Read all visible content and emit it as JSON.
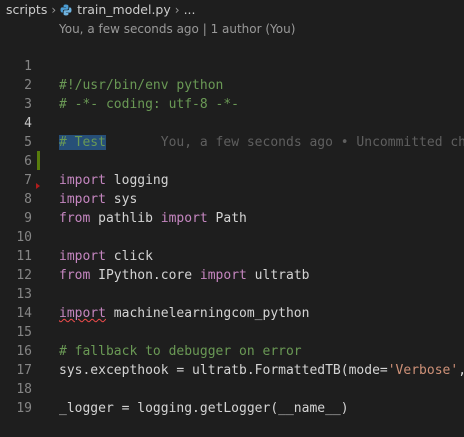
{
  "breadcrumb": {
    "folder": "scripts",
    "file": "train_model.py",
    "ellipsis": "..."
  },
  "codelens": "You, a few seconds ago | 1 author (You)",
  "blame": "You, a few seconds ago • Uncommitted chan",
  "colors": {
    "comment": "#6a9955",
    "keyword": "#c586c0",
    "string": "#ce9178",
    "selection": "#264f78"
  },
  "lines": [
    {
      "n": "1",
      "text": "#!/usr/bin/env python"
    },
    {
      "n": "2",
      "text": "# -*- coding: utf-8 -*-"
    },
    {
      "n": "3",
      "text": ""
    },
    {
      "n": "4",
      "text": "# Test"
    },
    {
      "n": "5",
      "text": ""
    },
    {
      "n": "6",
      "kw1": "import",
      "rest1": " logging"
    },
    {
      "n": "7",
      "kw1": "import",
      "rest1": " sys"
    },
    {
      "n": "8",
      "kw1": "from",
      "rest1": " pathlib ",
      "kw2": "import",
      "rest2": " Path"
    },
    {
      "n": "9",
      "text": ""
    },
    {
      "n": "10",
      "kw1": "import",
      "rest1": " click"
    },
    {
      "n": "11",
      "kw1": "from",
      "rest1": " IPython.core ",
      "kw2": "import",
      "rest2": " ultratb"
    },
    {
      "n": "12",
      "text": ""
    },
    {
      "n": "13",
      "kw1": "import",
      "rest1": " machinelearningcom_python"
    },
    {
      "n": "14",
      "text": ""
    },
    {
      "n": "15",
      "text": "# fallback to debugger on error"
    },
    {
      "n": "16",
      "pre": "sys.excepthook = ultratb.FormattedTB(mode=",
      "str": "'Verbose'",
      "post": ","
    },
    {
      "n": "17",
      "text": ""
    },
    {
      "n": "18",
      "text": "_logger = logging.getLogger(__name__)"
    },
    {
      "n": "19",
      "text": ""
    }
  ]
}
